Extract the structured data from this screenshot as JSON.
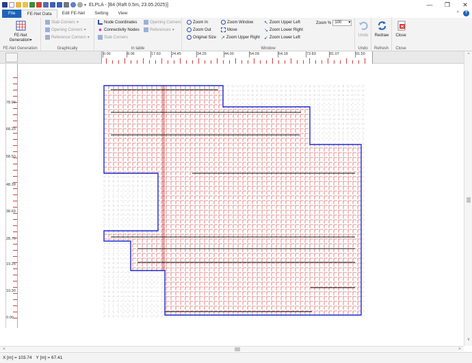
{
  "window": {
    "title": "ELPLA - [B4 (Raft 0.5m, 23.05.2025)]",
    "minimize": "—",
    "restore": "❐",
    "close": "✕"
  },
  "tabs": [
    {
      "label": "File"
    },
    {
      "label": "FE-Net Data"
    },
    {
      "label": "Edit FE-Net"
    },
    {
      "label": "Setting"
    },
    {
      "label": "View"
    }
  ],
  "ribbon": {
    "fe_net_generation": {
      "label": "FE-Net\nGeneration",
      "caret": "▾",
      "group_label": "FE-Net Generation"
    },
    "graphically": {
      "group_label": "Graphically",
      "slab_corners": "Slab Corners",
      "opening_corners": "Opening Corners",
      "reference_corners": "Reference Corners"
    },
    "in_table": {
      "group_label": "In table",
      "node_coordinates": "Node Coordinates",
      "connectivity_nodes": "Connectivity Nodes",
      "slab_corners": "Slab Corners",
      "opening_corners": "Opening Corners",
      "references": "References"
    },
    "window": {
      "group_label": "Window",
      "zoom_in": "Zoom In",
      "zoom_out": "Zoom Out",
      "original_size": "Original Size",
      "zoom_window": "Zoom Window",
      "move": "Move",
      "zoom_upper_right": "Zoom Upper Right",
      "zoom_upper_left": "Zoom Upper Left",
      "zoom_lower_right": "Zoom Lower Right",
      "zoom_lower_left": "Zoom Lower Left",
      "zoom_percent_label": "Zoom %",
      "zoom_value": "100"
    },
    "undo": {
      "label": "Undo",
      "group_label": "Undo"
    },
    "redraw": {
      "label": "Redraw",
      "group_label": "Refresh"
    },
    "close": {
      "label": "Close",
      "group_label": "Close"
    }
  },
  "rulers": {
    "x_labels": [
      "0.00",
      "8.06",
      "17.60",
      "24.45",
      "34.25",
      "44.00",
      "54.09",
      "64.18",
      "73.83",
      "81.07",
      "91.50"
    ],
    "y_labels": [
      "78.90",
      "68.20",
      "58.50",
      "48.39",
      "38.69",
      "28.75",
      "19.25",
      "10.30",
      "0.00"
    ]
  },
  "status": {
    "x_label": "X [m] =",
    "x_value": "103.74",
    "y_label": "Y [m] =",
    "y_value": "67.41"
  },
  "colors": {
    "file_tab": "#1f63b8",
    "mesh_red": "#d63a3a",
    "outline_blue": "#1a2bd6",
    "grid_gray": "#c8c8c8"
  },
  "icons": {
    "app": "elpla-logo-icon",
    "help": "help-icon",
    "collapse": "chevron-up-icon"
  }
}
